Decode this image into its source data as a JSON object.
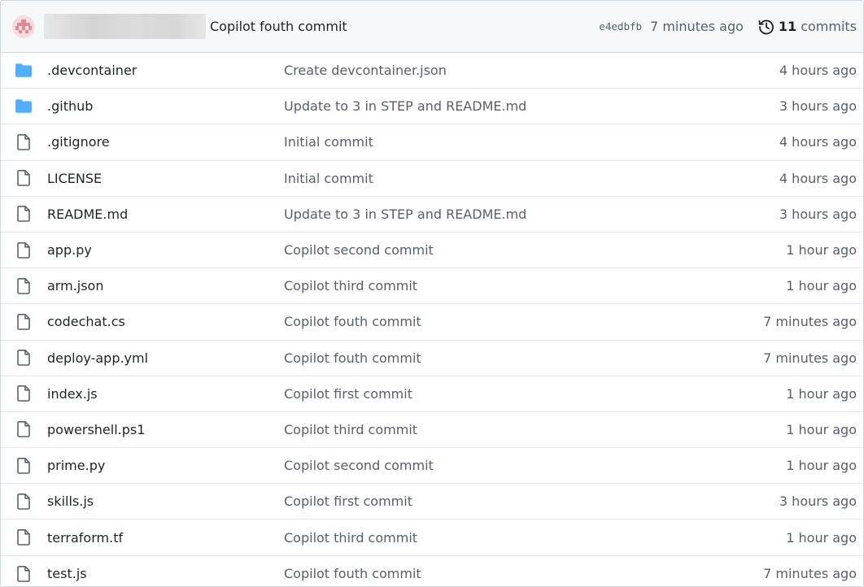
{
  "latest_commit": {
    "avatar_icon": "identicon-avatar",
    "author_redacted": true,
    "message": "Copilot fouth commit",
    "sha": "e4edbfb",
    "age": "7 minutes ago",
    "history_icon": "history-icon",
    "commit_count": "11",
    "commits_label": "commits"
  },
  "colors": {
    "folder": "#54aeff",
    "file_icon": "#57606a",
    "muted_text": "#57606a",
    "header_bg": "#f6f8fa",
    "avatar": "#dc8a96"
  },
  "files": [
    {
      "type": "folder",
      "icon": "folder-icon",
      "name": ".devcontainer",
      "message": "Create devcontainer.json",
      "age": "4 hours ago"
    },
    {
      "type": "folder",
      "icon": "folder-icon",
      "name": ".github",
      "message": "Update to 3 in STEP and README.md",
      "age": "3 hours ago"
    },
    {
      "type": "file",
      "icon": "file-icon",
      "name": ".gitignore",
      "message": "Initial commit",
      "age": "4 hours ago"
    },
    {
      "type": "file",
      "icon": "file-icon",
      "name": "LICENSE",
      "message": "Initial commit",
      "age": "4 hours ago"
    },
    {
      "type": "file",
      "icon": "file-icon",
      "name": "README.md",
      "message": "Update to 3 in STEP and README.md",
      "age": "3 hours ago"
    },
    {
      "type": "file",
      "icon": "file-icon",
      "name": "app.py",
      "message": "Copilot second commit",
      "age": "1 hour ago"
    },
    {
      "type": "file",
      "icon": "file-icon",
      "name": "arm.json",
      "message": "Copilot third commit",
      "age": "1 hour ago"
    },
    {
      "type": "file",
      "icon": "file-icon",
      "name": "codechat.cs",
      "message": "Copilot fouth commit",
      "age": "7 minutes ago"
    },
    {
      "type": "file",
      "icon": "file-icon",
      "name": "deploy-app.yml",
      "message": "Copilot fouth commit",
      "age": "7 minutes ago"
    },
    {
      "type": "file",
      "icon": "file-icon",
      "name": "index.js",
      "message": "Copilot first commit",
      "age": "1 hour ago"
    },
    {
      "type": "file",
      "icon": "file-icon",
      "name": "powershell.ps1",
      "message": "Copilot third commit",
      "age": "1 hour ago"
    },
    {
      "type": "file",
      "icon": "file-icon",
      "name": "prime.py",
      "message": "Copilot second commit",
      "age": "1 hour ago"
    },
    {
      "type": "file",
      "icon": "file-icon",
      "name": "skills.js",
      "message": "Copilot first commit",
      "age": "3 hours ago"
    },
    {
      "type": "file",
      "icon": "file-icon",
      "name": "terraform.tf",
      "message": "Copilot third commit",
      "age": "1 hour ago"
    },
    {
      "type": "file",
      "icon": "file-icon",
      "name": "test.js",
      "message": "Copilot fouth commit",
      "age": "7 minutes ago"
    }
  ]
}
